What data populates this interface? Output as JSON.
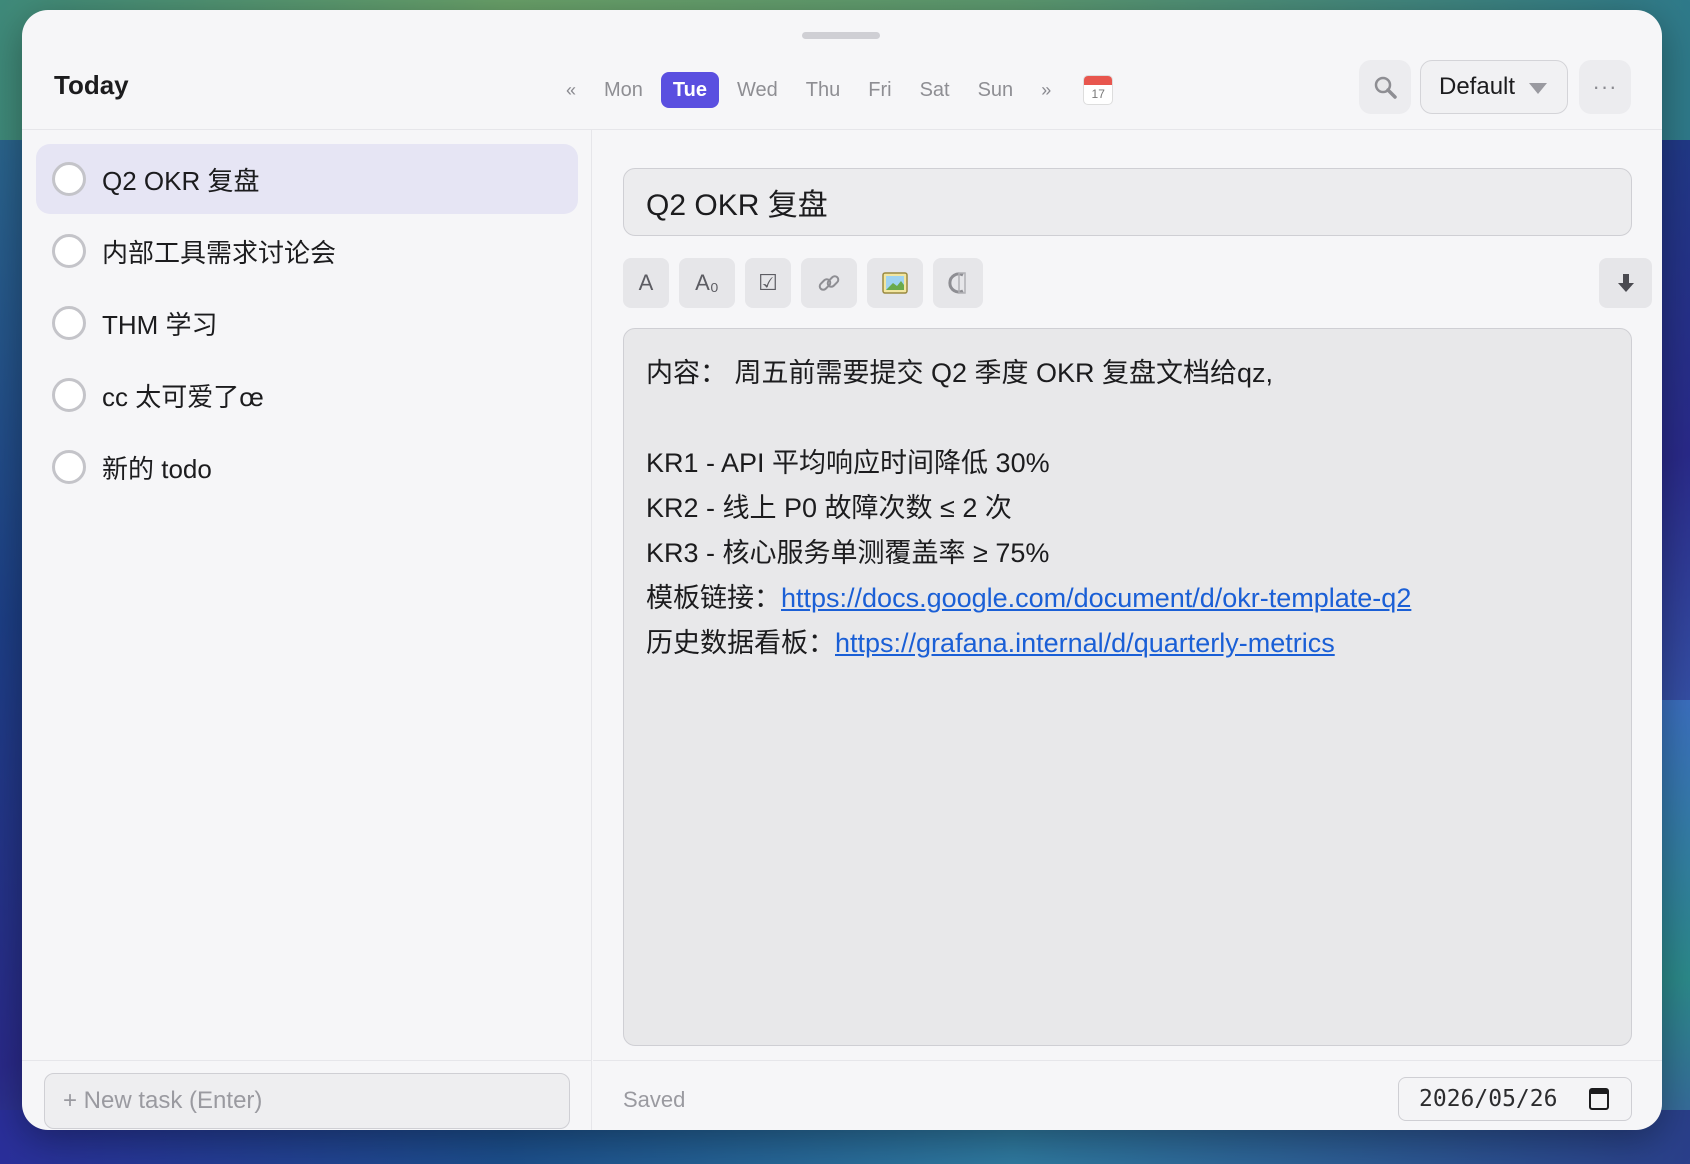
{
  "header": {
    "title": "Today",
    "prev_arrow": "«",
    "next_arrow": "»",
    "days": [
      "Mon",
      "Tue",
      "Wed",
      "Thu",
      "Fri",
      "Sat",
      "Sun"
    ],
    "active_day": "Tue",
    "calendar_icon_day": "17",
    "search_icon": "search-icon",
    "view_select": "Default",
    "more_label": "···"
  },
  "tasks": [
    {
      "label": "Q2 OKR 复盘",
      "selected": true
    },
    {
      "label": "内部工具需求讨论会",
      "selected": false
    },
    {
      "label": "THM 学习",
      "selected": false
    },
    {
      "label": "cc 太可爱了œ",
      "selected": false
    },
    {
      "label": "新的 todo",
      "selected": false
    }
  ],
  "new_task": {
    "placeholder": "+ New task (Enter)"
  },
  "editor": {
    "title": "Q2 OKR 复盘",
    "toolbar": {
      "text_btn": "A",
      "subscript_btn": "A₀",
      "checkbox_btn": "☑",
      "link_btn": "link-icon",
      "image_btn": "image-icon",
      "code_btn": "code-icon",
      "download_btn": "download-icon"
    },
    "content": {
      "line1": "内容：  周五前需要提交 Q2 季度 OKR 复盘文档给qz,",
      "line2": "KR1 - API 平均响应时间降低 30%",
      "line3": "KR2 - 线上 P0 故障次数 ≤ 2 次",
      "line4": "KR3 - 核心服务单测覆盖率 ≥ 75%",
      "template_label": "模板链接：",
      "template_url": "https://docs.google.com/document/d/okr-template-q2",
      "history_label": "历史数据看板：",
      "history_url": "https://grafana.internal/d/quarterly-metrics"
    }
  },
  "footer": {
    "status": "Saved",
    "date": "2026/05/26"
  },
  "colors": {
    "accent": "#5a4fe0",
    "link": "#1a5fd6",
    "selected_row": "#e6e5f4"
  }
}
